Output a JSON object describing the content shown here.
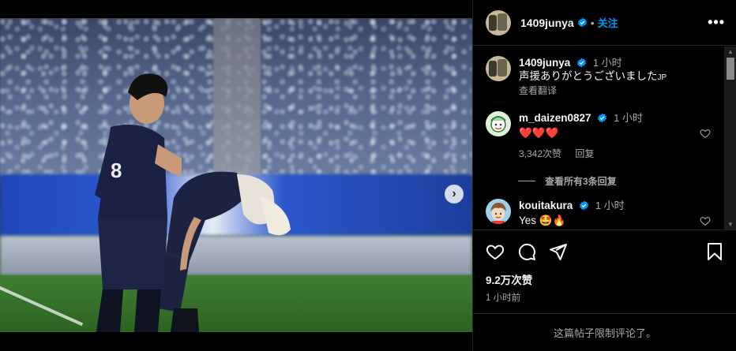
{
  "post": {
    "username": "1409junya",
    "follow_label": "关注",
    "bullet": "•",
    "more_label": "•••",
    "media_dots": 3,
    "media_active_index": 0
  },
  "caption": {
    "username": "1409junya",
    "time": "1 小时",
    "text": "声援ありがとうございました",
    "lang_tag": "JP",
    "translate_label": "查看翻译"
  },
  "comments": [
    {
      "username": "m_daizen0827",
      "time": "1 小时",
      "text": "❤️❤️❤️",
      "likes": "3,342次赞",
      "reply_label": "回复",
      "view_replies": "查看所有3条回复"
    },
    {
      "username": "kouitakura",
      "time": "1 小时",
      "text": "Yes 🤩🔥"
    }
  ],
  "stats": {
    "likes": "9.2万次赞",
    "time": "1 小时前"
  },
  "footer": {
    "comments_closed": "这篇帖子限制评论了。"
  },
  "colors": {
    "accent": "#0095f6",
    "muted": "#a8a8a8",
    "background": "#000000"
  },
  "icons": {
    "verified": "verified-badge-icon",
    "heart": "heart-outline-icon",
    "comment": "comment-bubble-icon",
    "share": "paper-plane-icon",
    "bookmark": "bookmark-icon",
    "next": "chevron-right-icon"
  }
}
